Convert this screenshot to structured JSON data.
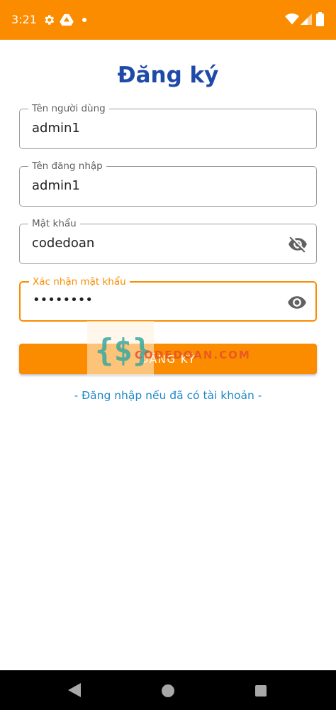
{
  "status_bar": {
    "time": "3:21",
    "background_color": "#fb8c00",
    "icons": [
      "gear-icon",
      "drive-icon",
      "notification-dot-icon",
      "wifi-icon",
      "signal-icon",
      "battery-icon"
    ]
  },
  "page": {
    "title": "Đăng ký",
    "title_color": "#1f4aa8"
  },
  "form": {
    "username": {
      "label": "Tên người dùng",
      "value": "admin1"
    },
    "login_name": {
      "label": "Tên đăng nhập",
      "value": "admin1"
    },
    "password": {
      "label": "Mật khẩu",
      "value": "codedoan",
      "toggle_icon": "eye-off-icon"
    },
    "confirm_password": {
      "label": "Xác nhận mật khẩu",
      "value": "••••••••",
      "toggle_icon": "eye-icon",
      "focused": true
    }
  },
  "submit_button": {
    "label": "ĐĂNG KÝ",
    "color": "#fb8c00"
  },
  "login_link": {
    "text": "- Đăng nhập nếu đã có tài khoản -"
  },
  "watermark": {
    "logo": "{$}",
    "text": "CODEDOAN.COM"
  },
  "nav_bar": {
    "icons": [
      "back-icon",
      "home-icon",
      "recents-icon"
    ]
  }
}
